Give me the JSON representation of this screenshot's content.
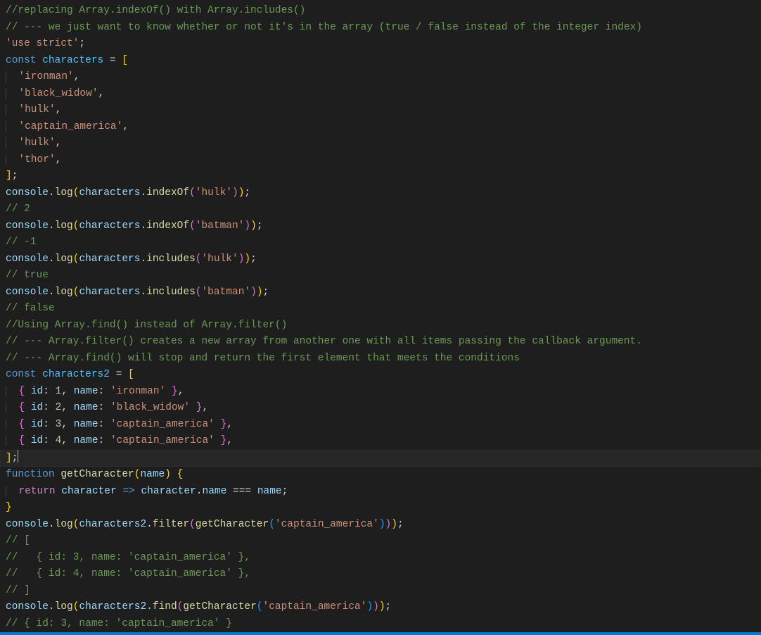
{
  "language": "javascript",
  "cursor": {
    "line": 28,
    "col": 2
  },
  "colors": {
    "background": "#1e1e1e",
    "statusbar": "#007acc",
    "comment": "#6a9955",
    "string": "#ce9178",
    "keyword": "#569cd6",
    "variable": "#4fc1ff",
    "parameter": "#9cdcfe",
    "function": "#dcdcaa",
    "number": "#b5cea8",
    "controlflow": "#c586c0"
  },
  "lines": [
    [
      {
        "t": "comment",
        "v": "//replacing Array.indexOf() with Array.includes()"
      }
    ],
    [
      {
        "t": "comment",
        "v": "// --- we just want to know whether or not it's in the array (true / false instead of the integer index)"
      }
    ],
    [
      {
        "t": "string",
        "v": "'use strict'"
      },
      {
        "t": "punct",
        "v": ";"
      }
    ],
    [
      {
        "t": "const",
        "v": "const"
      },
      {
        "t": "punct",
        "v": " "
      },
      {
        "t": "var",
        "v": "characters"
      },
      {
        "t": "punct",
        "v": " = "
      },
      {
        "t": "brace0",
        "v": "["
      }
    ],
    [
      {
        "t": "indent",
        "v": "  "
      },
      {
        "t": "string",
        "v": "'ironman'"
      },
      {
        "t": "punct",
        "v": ","
      }
    ],
    [
      {
        "t": "indent",
        "v": "  "
      },
      {
        "t": "string",
        "v": "'black_widow'"
      },
      {
        "t": "punct",
        "v": ","
      }
    ],
    [
      {
        "t": "indent",
        "v": "  "
      },
      {
        "t": "string",
        "v": "'hulk'"
      },
      {
        "t": "punct",
        "v": ","
      }
    ],
    [
      {
        "t": "indent",
        "v": "  "
      },
      {
        "t": "string",
        "v": "'captain_america'"
      },
      {
        "t": "punct",
        "v": ","
      }
    ],
    [
      {
        "t": "indent",
        "v": "  "
      },
      {
        "t": "string",
        "v": "'hulk'"
      },
      {
        "t": "punct",
        "v": ","
      }
    ],
    [
      {
        "t": "indent",
        "v": "  "
      },
      {
        "t": "string",
        "v": "'thor'"
      },
      {
        "t": "punct",
        "v": ","
      }
    ],
    [
      {
        "t": "brace0",
        "v": "]"
      },
      {
        "t": "punct",
        "v": ";"
      }
    ],
    [
      {
        "t": "prop",
        "v": "console"
      },
      {
        "t": "punct",
        "v": "."
      },
      {
        "t": "func",
        "v": "log"
      },
      {
        "t": "brace0",
        "v": "("
      },
      {
        "t": "prop",
        "v": "characters"
      },
      {
        "t": "punct",
        "v": "."
      },
      {
        "t": "func",
        "v": "indexOf"
      },
      {
        "t": "brace1",
        "v": "("
      },
      {
        "t": "string",
        "v": "'hulk'"
      },
      {
        "t": "brace1",
        "v": ")"
      },
      {
        "t": "brace0",
        "v": ")"
      },
      {
        "t": "punct",
        "v": ";"
      }
    ],
    [
      {
        "t": "comment",
        "v": "// 2"
      }
    ],
    [
      {
        "t": "prop",
        "v": "console"
      },
      {
        "t": "punct",
        "v": "."
      },
      {
        "t": "func",
        "v": "log"
      },
      {
        "t": "brace0",
        "v": "("
      },
      {
        "t": "prop",
        "v": "characters"
      },
      {
        "t": "punct",
        "v": "."
      },
      {
        "t": "func",
        "v": "indexOf"
      },
      {
        "t": "brace1",
        "v": "("
      },
      {
        "t": "string",
        "v": "'batman'"
      },
      {
        "t": "brace1",
        "v": ")"
      },
      {
        "t": "brace0",
        "v": ")"
      },
      {
        "t": "punct",
        "v": ";"
      }
    ],
    [
      {
        "t": "comment",
        "v": "// -1"
      }
    ],
    [
      {
        "t": "prop",
        "v": "console"
      },
      {
        "t": "punct",
        "v": "."
      },
      {
        "t": "func",
        "v": "log"
      },
      {
        "t": "brace0",
        "v": "("
      },
      {
        "t": "prop",
        "v": "characters"
      },
      {
        "t": "punct",
        "v": "."
      },
      {
        "t": "func",
        "v": "includes"
      },
      {
        "t": "brace1",
        "v": "("
      },
      {
        "t": "string",
        "v": "'hulk'"
      },
      {
        "t": "brace1",
        "v": ")"
      },
      {
        "t": "brace0",
        "v": ")"
      },
      {
        "t": "punct",
        "v": ";"
      }
    ],
    [
      {
        "t": "comment",
        "v": "// true"
      }
    ],
    [
      {
        "t": "prop",
        "v": "console"
      },
      {
        "t": "punct",
        "v": "."
      },
      {
        "t": "func",
        "v": "log"
      },
      {
        "t": "brace0",
        "v": "("
      },
      {
        "t": "prop",
        "v": "characters"
      },
      {
        "t": "punct",
        "v": "."
      },
      {
        "t": "func",
        "v": "includes"
      },
      {
        "t": "brace1",
        "v": "("
      },
      {
        "t": "string",
        "v": "'batman'"
      },
      {
        "t": "brace1",
        "v": ")"
      },
      {
        "t": "brace0",
        "v": ")"
      },
      {
        "t": "punct",
        "v": ";"
      }
    ],
    [
      {
        "t": "comment",
        "v": "// false"
      }
    ],
    [
      {
        "t": "comment",
        "v": "//Using Array.find() instead of Array.filter()"
      }
    ],
    [
      {
        "t": "comment",
        "v": "// --- Array.filter() creates a new array from another one with all items passing the callback argument."
      }
    ],
    [
      {
        "t": "comment",
        "v": "// --- Array.find() will stop and return the first element that meets the conditions"
      }
    ],
    [
      {
        "t": "const",
        "v": "const"
      },
      {
        "t": "punct",
        "v": " "
      },
      {
        "t": "var",
        "v": "characters2"
      },
      {
        "t": "punct",
        "v": " = "
      },
      {
        "t": "brace0",
        "v": "["
      }
    ],
    [
      {
        "t": "indent",
        "v": "  "
      },
      {
        "t": "brace1",
        "v": "{"
      },
      {
        "t": "punct",
        "v": " "
      },
      {
        "t": "prop",
        "v": "id"
      },
      {
        "t": "punct",
        "v": ": "
      },
      {
        "t": "number",
        "v": "1"
      },
      {
        "t": "punct",
        "v": ", "
      },
      {
        "t": "prop",
        "v": "name"
      },
      {
        "t": "punct",
        "v": ": "
      },
      {
        "t": "string",
        "v": "'ironman'"
      },
      {
        "t": "punct",
        "v": " "
      },
      {
        "t": "brace1",
        "v": "}"
      },
      {
        "t": "punct",
        "v": ","
      }
    ],
    [
      {
        "t": "indent",
        "v": "  "
      },
      {
        "t": "brace1",
        "v": "{"
      },
      {
        "t": "punct",
        "v": " "
      },
      {
        "t": "prop",
        "v": "id"
      },
      {
        "t": "punct",
        "v": ": "
      },
      {
        "t": "number",
        "v": "2"
      },
      {
        "t": "punct",
        "v": ", "
      },
      {
        "t": "prop",
        "v": "name"
      },
      {
        "t": "punct",
        "v": ": "
      },
      {
        "t": "string",
        "v": "'black_widow'"
      },
      {
        "t": "punct",
        "v": " "
      },
      {
        "t": "brace1",
        "v": "}"
      },
      {
        "t": "punct",
        "v": ","
      }
    ],
    [
      {
        "t": "indent",
        "v": "  "
      },
      {
        "t": "brace1",
        "v": "{"
      },
      {
        "t": "punct",
        "v": " "
      },
      {
        "t": "prop",
        "v": "id"
      },
      {
        "t": "punct",
        "v": ": "
      },
      {
        "t": "number",
        "v": "3"
      },
      {
        "t": "punct",
        "v": ", "
      },
      {
        "t": "prop",
        "v": "name"
      },
      {
        "t": "punct",
        "v": ": "
      },
      {
        "t": "string",
        "v": "'captain_america'"
      },
      {
        "t": "punct",
        "v": " "
      },
      {
        "t": "brace1",
        "v": "}"
      },
      {
        "t": "punct",
        "v": ","
      }
    ],
    [
      {
        "t": "indent",
        "v": "  "
      },
      {
        "t": "brace1",
        "v": "{"
      },
      {
        "t": "punct",
        "v": " "
      },
      {
        "t": "prop",
        "v": "id"
      },
      {
        "t": "punct",
        "v": ": "
      },
      {
        "t": "number",
        "v": "4"
      },
      {
        "t": "punct",
        "v": ", "
      },
      {
        "t": "prop",
        "v": "name"
      },
      {
        "t": "punct",
        "v": ": "
      },
      {
        "t": "string",
        "v": "'captain_america'"
      },
      {
        "t": "punct",
        "v": " "
      },
      {
        "t": "brace1",
        "v": "}"
      },
      {
        "t": "punct",
        "v": ","
      }
    ],
    [
      {
        "t": "brace0",
        "v": "]"
      },
      {
        "t": "punct",
        "v": ";"
      }
    ],
    [
      {
        "t": "keyword",
        "v": "function"
      },
      {
        "t": "punct",
        "v": " "
      },
      {
        "t": "func",
        "v": "getCharacter"
      },
      {
        "t": "brace0",
        "v": "("
      },
      {
        "t": "param",
        "v": "name"
      },
      {
        "t": "brace0",
        "v": ")"
      },
      {
        "t": "punct",
        "v": " "
      },
      {
        "t": "brace0",
        "v": "{"
      }
    ],
    [
      {
        "t": "indent",
        "v": "  "
      },
      {
        "t": "return",
        "v": "return"
      },
      {
        "t": "punct",
        "v": " "
      },
      {
        "t": "param",
        "v": "character"
      },
      {
        "t": "punct",
        "v": " "
      },
      {
        "t": "keyword",
        "v": "=>"
      },
      {
        "t": "punct",
        "v": " "
      },
      {
        "t": "param",
        "v": "character"
      },
      {
        "t": "punct",
        "v": "."
      },
      {
        "t": "prop",
        "v": "name"
      },
      {
        "t": "punct",
        "v": " === "
      },
      {
        "t": "param",
        "v": "name"
      },
      {
        "t": "punct",
        "v": ";"
      }
    ],
    [
      {
        "t": "brace0",
        "v": "}"
      }
    ],
    [
      {
        "t": "prop",
        "v": "console"
      },
      {
        "t": "punct",
        "v": "."
      },
      {
        "t": "func",
        "v": "log"
      },
      {
        "t": "brace0",
        "v": "("
      },
      {
        "t": "prop",
        "v": "characters2"
      },
      {
        "t": "punct",
        "v": "."
      },
      {
        "t": "func",
        "v": "filter"
      },
      {
        "t": "brace1",
        "v": "("
      },
      {
        "t": "func",
        "v": "getCharacter"
      },
      {
        "t": "brace2",
        "v": "("
      },
      {
        "t": "string",
        "v": "'captain_america'"
      },
      {
        "t": "brace2",
        "v": ")"
      },
      {
        "t": "brace1",
        "v": ")"
      },
      {
        "t": "brace0",
        "v": ")"
      },
      {
        "t": "punct",
        "v": ";"
      }
    ],
    [
      {
        "t": "comment",
        "v": "// ["
      }
    ],
    [
      {
        "t": "comment",
        "v": "//   { id: 3, name: 'captain_america' },"
      }
    ],
    [
      {
        "t": "comment",
        "v": "//   { id: 4, name: 'captain_america' },"
      }
    ],
    [
      {
        "t": "comment",
        "v": "// ]"
      }
    ],
    [
      {
        "t": "prop",
        "v": "console"
      },
      {
        "t": "punct",
        "v": "."
      },
      {
        "t": "func",
        "v": "log"
      },
      {
        "t": "brace0",
        "v": "("
      },
      {
        "t": "prop",
        "v": "characters2"
      },
      {
        "t": "punct",
        "v": "."
      },
      {
        "t": "func",
        "v": "find"
      },
      {
        "t": "brace1",
        "v": "("
      },
      {
        "t": "func",
        "v": "getCharacter"
      },
      {
        "t": "brace2",
        "v": "("
      },
      {
        "t": "string",
        "v": "'captain_america'"
      },
      {
        "t": "brace2",
        "v": ")"
      },
      {
        "t": "brace1",
        "v": ")"
      },
      {
        "t": "brace0",
        "v": ")"
      },
      {
        "t": "punct",
        "v": ";"
      }
    ],
    [
      {
        "t": "comment",
        "v": "// { id: 3, name: 'captain_america' }"
      }
    ]
  ]
}
